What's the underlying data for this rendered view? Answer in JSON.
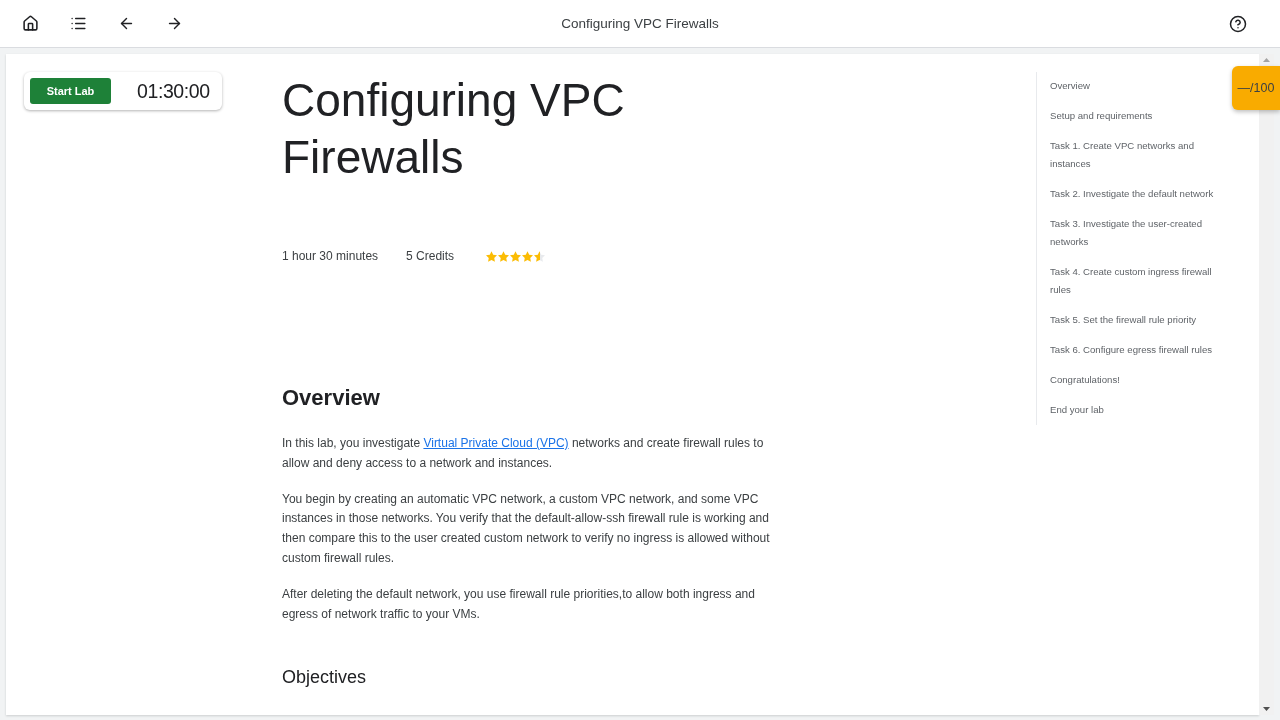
{
  "header": {
    "title": "Configuring VPC Firewalls"
  },
  "lab_control": {
    "button": "Start Lab",
    "timer": "01:30:00"
  },
  "lab": {
    "title": "Configuring VPC Firewalls",
    "duration": "1 hour 30 minutes",
    "credits": "5 Credits",
    "stars": 4.5
  },
  "overview": {
    "heading": "Overview",
    "paragraphs": [
      [
        {
          "kind": "text",
          "text": "In this lab, you investigate "
        },
        {
          "kind": "link",
          "text": "Virtual Private Cloud (VPC)"
        },
        {
          "kind": "text",
          "text": " networks and create firewall rules to allow and deny access to a network and instances."
        }
      ],
      [
        {
          "kind": "text",
          "text": "You begin by creating an automatic VPC network, a custom VPC network, and some VPC instances in those networks. You verify that the default-allow-ssh firewall rule is working and then compare this to the user created custom network to verify no ingress is allowed without custom firewall rules."
        }
      ],
      [
        {
          "kind": "text",
          "text": "After deleting the default network, you use firewall rule priorities,to allow both ingress and egress of network traffic to your VMs."
        }
      ]
    ]
  },
  "objectives": {
    "heading": "Objectives"
  },
  "toc": {
    "items": [
      {
        "label": "Overview",
        "selected": false
      },
      {
        "label": "Setup and requirements",
        "selected": false
      },
      {
        "label": "Task 1. Create VPC networks and instances",
        "selected": false
      },
      {
        "label": "Task 2. Investigate the default network",
        "selected": false
      },
      {
        "label": "Task 3. Investigate the user-created networks",
        "selected": false
      },
      {
        "label": "Task 4. Create custom ingress firewall rules",
        "selected": false
      },
      {
        "label": "Task 5. Set the firewall rule priority",
        "selected": false
      },
      {
        "label": "Task 6. Configure egress firewall rules",
        "selected": false
      },
      {
        "label": "Congratulations!",
        "selected": false
      },
      {
        "label": "End your lab",
        "selected": false
      }
    ]
  },
  "score": {
    "text": "—/100"
  }
}
